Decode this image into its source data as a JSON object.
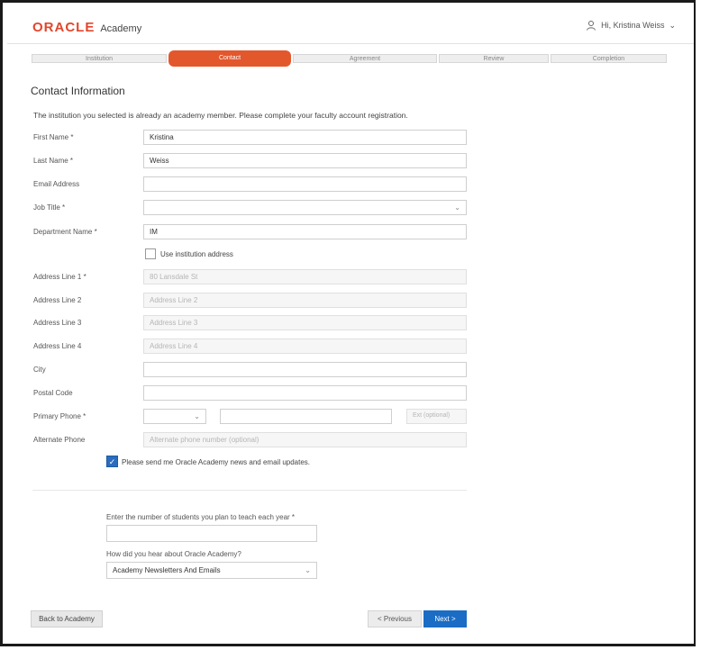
{
  "header": {
    "logo_brand": "ORACLE",
    "logo_product": "Academy",
    "user_name": "Hi, Kristina Weiss"
  },
  "stepper": {
    "steps": [
      "Institution",
      "Contact",
      "Agreement",
      "Review",
      "Completion"
    ],
    "active_index": 1
  },
  "page": {
    "title": "Contact Information",
    "notice": "The institution you selected is already an academy member. Please complete your faculty account registration."
  },
  "form": {
    "first_name": {
      "label": "First Name *",
      "value": "Kristina"
    },
    "last_name": {
      "label": "Last Name *",
      "value": "Weiss"
    },
    "email": {
      "label": "Email Address",
      "value": ""
    },
    "job_title": {
      "label": "Job Title *",
      "value": ""
    },
    "department": {
      "label": "Department Name *",
      "value": "IM"
    },
    "use_institution_address": {
      "label": "Use institution address",
      "checked": false
    },
    "address1": {
      "label": "Address Line 1 *",
      "placeholder": "80 Lansdale St"
    },
    "address2": {
      "label": "Address Line 2",
      "placeholder": "Address Line 2"
    },
    "address3": {
      "label": "Address Line 3",
      "placeholder": "Address Line 3"
    },
    "address4": {
      "label": "Address Line 4",
      "placeholder": "Address Line 4"
    },
    "city": {
      "label": "City",
      "value": ""
    },
    "postal_code": {
      "label": "Postal Code",
      "value": ""
    },
    "primary_phone": {
      "label": "Primary Phone *",
      "ext_placeholder": "Ext (optional)"
    },
    "alternate_phone": {
      "label": "Alternate Phone",
      "placeholder": "Alternate phone number (optional)"
    },
    "newsletter": {
      "label": "Please send me Oracle Academy news and email updates.",
      "checked": true
    }
  },
  "survey": {
    "students_question": "Enter the number of students you plan to teach each year *",
    "students_value": "",
    "hear_question": "How did you hear about Oracle Academy?",
    "hear_value": "Academy Newsletters And Emails"
  },
  "buttons": {
    "back": "Back to Academy",
    "previous": "< Previous",
    "next": "Next >"
  },
  "colors": {
    "brand": "#e2462c",
    "active_step": "#e3572d",
    "primary_button": "#1a6cc4"
  }
}
